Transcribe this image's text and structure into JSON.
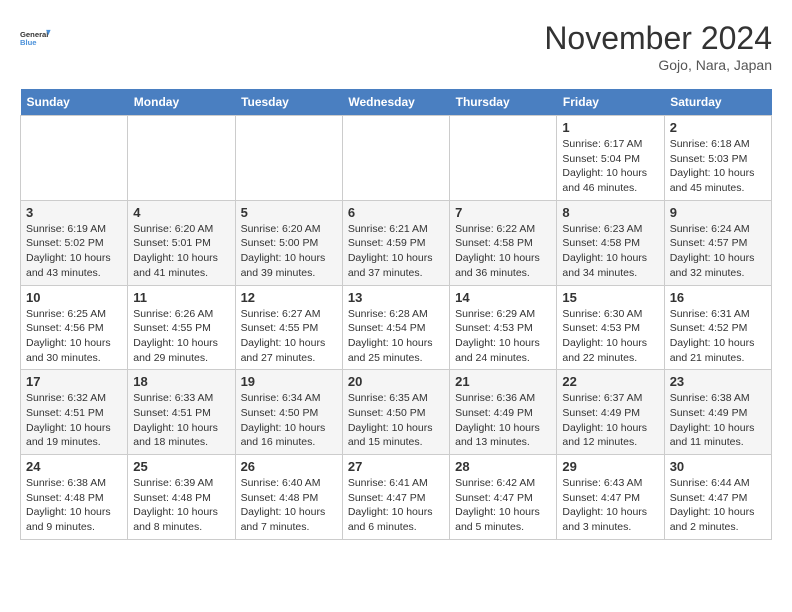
{
  "header": {
    "logo_line1": "General",
    "logo_line2": "Blue",
    "month": "November 2024",
    "location": "Gojo, Nara, Japan"
  },
  "weekdays": [
    "Sunday",
    "Monday",
    "Tuesday",
    "Wednesday",
    "Thursday",
    "Friday",
    "Saturday"
  ],
  "weeks": [
    [
      {
        "day": "",
        "info": ""
      },
      {
        "day": "",
        "info": ""
      },
      {
        "day": "",
        "info": ""
      },
      {
        "day": "",
        "info": ""
      },
      {
        "day": "",
        "info": ""
      },
      {
        "day": "1",
        "info": "Sunrise: 6:17 AM\nSunset: 5:04 PM\nDaylight: 10 hours\nand 46 minutes."
      },
      {
        "day": "2",
        "info": "Sunrise: 6:18 AM\nSunset: 5:03 PM\nDaylight: 10 hours\nand 45 minutes."
      }
    ],
    [
      {
        "day": "3",
        "info": "Sunrise: 6:19 AM\nSunset: 5:02 PM\nDaylight: 10 hours\nand 43 minutes."
      },
      {
        "day": "4",
        "info": "Sunrise: 6:20 AM\nSunset: 5:01 PM\nDaylight: 10 hours\nand 41 minutes."
      },
      {
        "day": "5",
        "info": "Sunrise: 6:20 AM\nSunset: 5:00 PM\nDaylight: 10 hours\nand 39 minutes."
      },
      {
        "day": "6",
        "info": "Sunrise: 6:21 AM\nSunset: 4:59 PM\nDaylight: 10 hours\nand 37 minutes."
      },
      {
        "day": "7",
        "info": "Sunrise: 6:22 AM\nSunset: 4:58 PM\nDaylight: 10 hours\nand 36 minutes."
      },
      {
        "day": "8",
        "info": "Sunrise: 6:23 AM\nSunset: 4:58 PM\nDaylight: 10 hours\nand 34 minutes."
      },
      {
        "day": "9",
        "info": "Sunrise: 6:24 AM\nSunset: 4:57 PM\nDaylight: 10 hours\nand 32 minutes."
      }
    ],
    [
      {
        "day": "10",
        "info": "Sunrise: 6:25 AM\nSunset: 4:56 PM\nDaylight: 10 hours\nand 30 minutes."
      },
      {
        "day": "11",
        "info": "Sunrise: 6:26 AM\nSunset: 4:55 PM\nDaylight: 10 hours\nand 29 minutes."
      },
      {
        "day": "12",
        "info": "Sunrise: 6:27 AM\nSunset: 4:55 PM\nDaylight: 10 hours\nand 27 minutes."
      },
      {
        "day": "13",
        "info": "Sunrise: 6:28 AM\nSunset: 4:54 PM\nDaylight: 10 hours\nand 25 minutes."
      },
      {
        "day": "14",
        "info": "Sunrise: 6:29 AM\nSunset: 4:53 PM\nDaylight: 10 hours\nand 24 minutes."
      },
      {
        "day": "15",
        "info": "Sunrise: 6:30 AM\nSunset: 4:53 PM\nDaylight: 10 hours\nand 22 minutes."
      },
      {
        "day": "16",
        "info": "Sunrise: 6:31 AM\nSunset: 4:52 PM\nDaylight: 10 hours\nand 21 minutes."
      }
    ],
    [
      {
        "day": "17",
        "info": "Sunrise: 6:32 AM\nSunset: 4:51 PM\nDaylight: 10 hours\nand 19 minutes."
      },
      {
        "day": "18",
        "info": "Sunrise: 6:33 AM\nSunset: 4:51 PM\nDaylight: 10 hours\nand 18 minutes."
      },
      {
        "day": "19",
        "info": "Sunrise: 6:34 AM\nSunset: 4:50 PM\nDaylight: 10 hours\nand 16 minutes."
      },
      {
        "day": "20",
        "info": "Sunrise: 6:35 AM\nSunset: 4:50 PM\nDaylight: 10 hours\nand 15 minutes."
      },
      {
        "day": "21",
        "info": "Sunrise: 6:36 AM\nSunset: 4:49 PM\nDaylight: 10 hours\nand 13 minutes."
      },
      {
        "day": "22",
        "info": "Sunrise: 6:37 AM\nSunset: 4:49 PM\nDaylight: 10 hours\nand 12 minutes."
      },
      {
        "day": "23",
        "info": "Sunrise: 6:38 AM\nSunset: 4:49 PM\nDaylight: 10 hours\nand 11 minutes."
      }
    ],
    [
      {
        "day": "24",
        "info": "Sunrise: 6:38 AM\nSunset: 4:48 PM\nDaylight: 10 hours\nand 9 minutes."
      },
      {
        "day": "25",
        "info": "Sunrise: 6:39 AM\nSunset: 4:48 PM\nDaylight: 10 hours\nand 8 minutes."
      },
      {
        "day": "26",
        "info": "Sunrise: 6:40 AM\nSunset: 4:48 PM\nDaylight: 10 hours\nand 7 minutes."
      },
      {
        "day": "27",
        "info": "Sunrise: 6:41 AM\nSunset: 4:47 PM\nDaylight: 10 hours\nand 6 minutes."
      },
      {
        "day": "28",
        "info": "Sunrise: 6:42 AM\nSunset: 4:47 PM\nDaylight: 10 hours\nand 5 minutes."
      },
      {
        "day": "29",
        "info": "Sunrise: 6:43 AM\nSunset: 4:47 PM\nDaylight: 10 hours\nand 3 minutes."
      },
      {
        "day": "30",
        "info": "Sunrise: 6:44 AM\nSunset: 4:47 PM\nDaylight: 10 hours\nand 2 minutes."
      }
    ]
  ]
}
